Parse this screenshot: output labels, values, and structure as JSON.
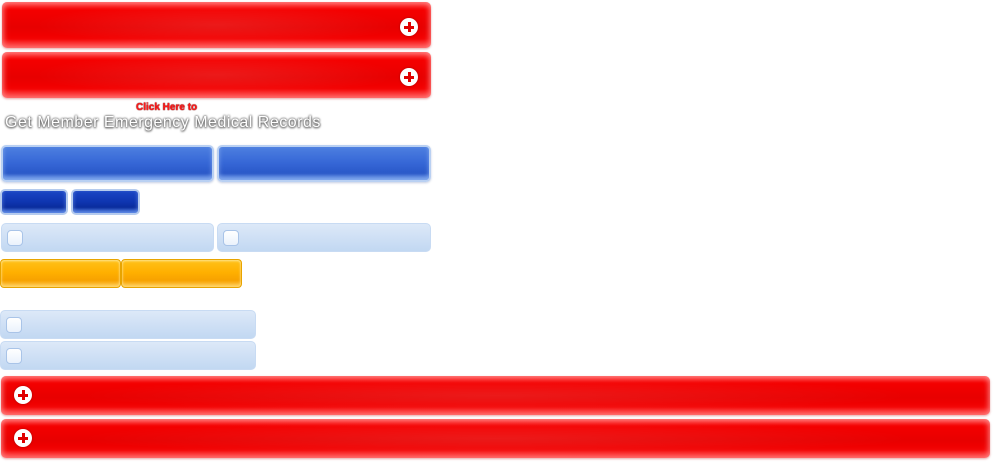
{
  "medical_link": {
    "click_here": "Click Here to",
    "title": "Get Member Emergency Medical Records"
  },
  "icons": {
    "expand": "plus-circle-icon",
    "checkbox": "checkbox-icon"
  },
  "colors": {
    "red_bar": "#f00000",
    "blue_button": "#3566d6",
    "dark_blue_button": "#0e35b0",
    "light_blue_bar": "#cfe0f5",
    "orange_button": "#ffb000",
    "link_text": "#ff1a1a"
  }
}
